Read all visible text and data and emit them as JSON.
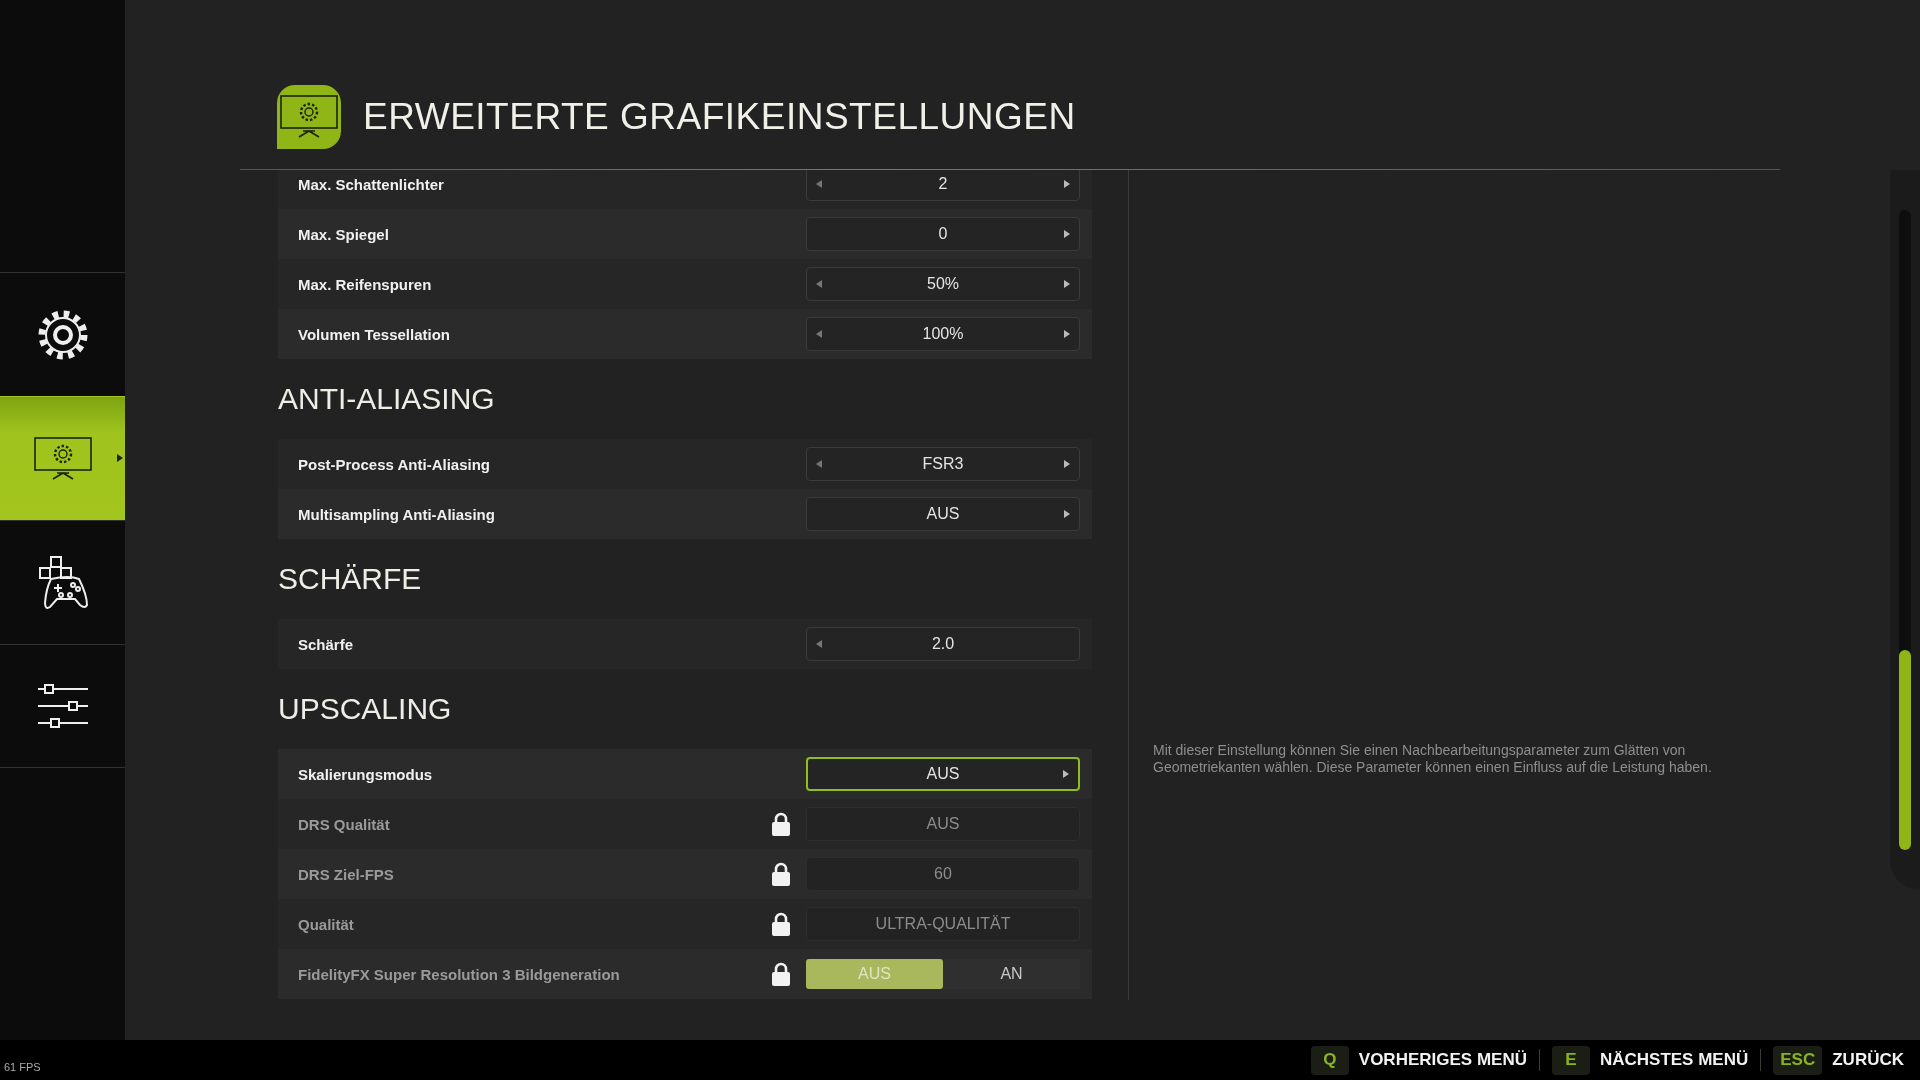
{
  "sidebar": {
    "items": [
      {
        "selected": false
      },
      {
        "selected": true
      },
      {
        "selected": false
      },
      {
        "selected": false
      }
    ]
  },
  "header": {
    "title": "ERWEITERTE GRAFIKEINSTELLUNGEN"
  },
  "sections": [
    {
      "settings": [
        {
          "kind": "selector",
          "label": "Max. Schattenlichter",
          "value": "2",
          "has_prev": true,
          "has_next": true,
          "focused": false,
          "locked": false
        },
        {
          "kind": "selector",
          "label": "Max. Spiegel",
          "value": "0",
          "has_prev": false,
          "has_next": true,
          "focused": false,
          "locked": false
        },
        {
          "kind": "selector",
          "label": "Max. Reifenspuren",
          "value": "50%",
          "has_prev": true,
          "has_next": true,
          "focused": false,
          "locked": false
        },
        {
          "kind": "selector",
          "label": "Volumen Tessellation",
          "value": "100%",
          "has_prev": true,
          "has_next": true,
          "focused": false,
          "locked": false
        }
      ]
    },
    {
      "title": "ANTI-ALIASING",
      "settings": [
        {
          "kind": "selector",
          "label": "Post-Process Anti-Aliasing",
          "value": "FSR3",
          "has_prev": true,
          "has_next": true,
          "focused": false,
          "locked": false
        },
        {
          "kind": "selector",
          "label": "Multisampling Anti-Aliasing",
          "value": "AUS",
          "has_prev": false,
          "has_next": true,
          "focused": false,
          "locked": false
        }
      ]
    },
    {
      "title": "SCHÄRFE",
      "settings": [
        {
          "kind": "selector",
          "label": "Schärfe",
          "value": "2.0",
          "has_prev": true,
          "has_next": false,
          "focused": false,
          "locked": false
        }
      ]
    },
    {
      "title": "UPSCALING",
      "settings": [
        {
          "kind": "selector",
          "label": "Skalierungsmodus",
          "value": "AUS",
          "has_prev": false,
          "has_next": true,
          "focused": true,
          "locked": false
        },
        {
          "kind": "selector",
          "label": "DRS Qualität",
          "value": "AUS",
          "has_prev": false,
          "has_next": false,
          "focused": false,
          "locked": true
        },
        {
          "kind": "selector",
          "label": "DRS Ziel-FPS",
          "value": "60",
          "has_prev": false,
          "has_next": false,
          "focused": false,
          "locked": true
        },
        {
          "kind": "selector",
          "label": "Qualität",
          "value": "ULTRA-QUALITÄT",
          "has_prev": false,
          "has_next": false,
          "focused": false,
          "locked": true
        },
        {
          "kind": "toggle",
          "label": "FidelityFX Super Resolution 3 Bildgeneration",
          "locked": true,
          "options": [
            {
              "label": "AUS",
              "selected": true
            },
            {
              "label": "AN",
              "selected": false
            }
          ]
        }
      ]
    }
  ],
  "description": "Mit dieser Einstellung können Sie einen Nachbearbeitungsparameter zum Glätten von Geometriekanten wählen. Diese Parameter können einen Einfluss auf die Leistung haben.",
  "status_bar": {
    "fps": "61 FPS",
    "hints": [
      {
        "key": "Q",
        "label": "VORHERIGES MENÜ"
      },
      {
        "key": "E",
        "label": "NÄCHSTES MENÜ"
      },
      {
        "key": "ESC",
        "label": "ZURÜCK"
      }
    ]
  }
}
